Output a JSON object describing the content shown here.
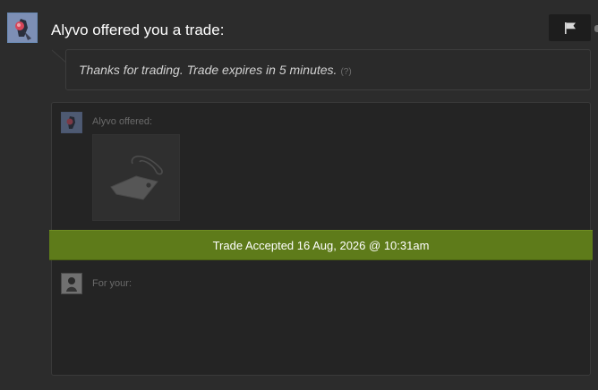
{
  "header": {
    "title": "Alyvo offered you a trade:",
    "report_icon": "flag-icon"
  },
  "message": {
    "text": "Thanks for trading. Trade expires in 5 minutes.",
    "help_link": "(?)"
  },
  "trade": {
    "partner_label": "Alyvo offered:",
    "items": [
      {
        "icon": "tag-icon"
      }
    ],
    "status": "Trade Accepted 16 Aug, 2026 @ 10:31am",
    "your_label": "For your:",
    "your_items": []
  },
  "colors": {
    "background": "#2c2c2c",
    "accepted_bar": "#5e7b1a",
    "headline_text": "#ffffff",
    "message_text": "#d2d2d2"
  }
}
